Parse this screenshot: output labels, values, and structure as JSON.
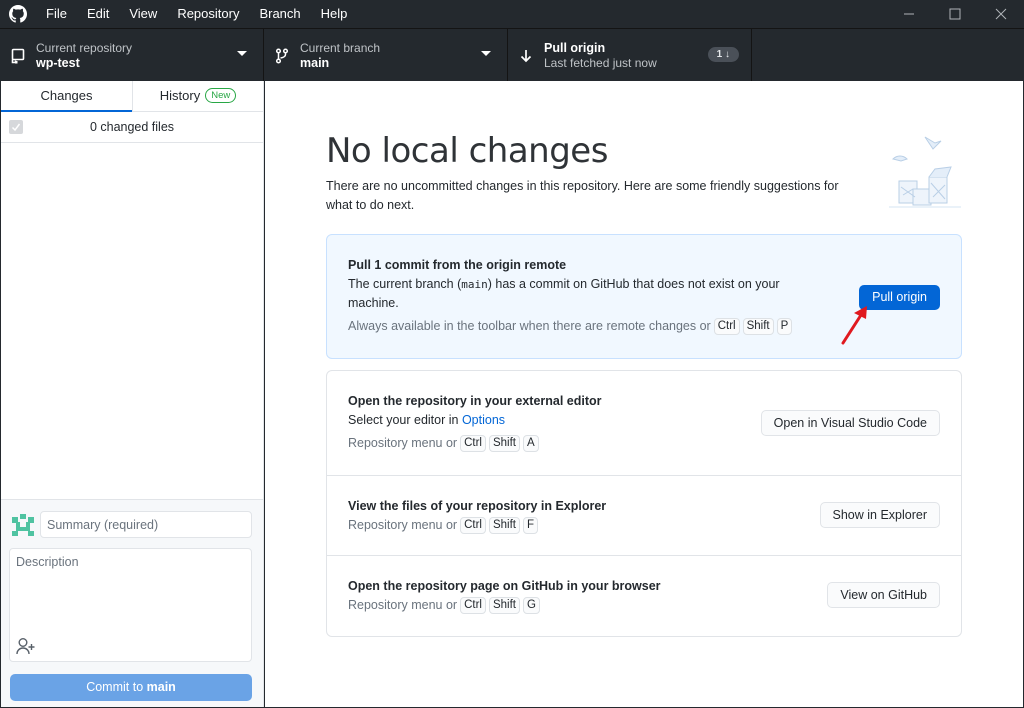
{
  "window": {
    "menu": [
      "File",
      "Edit",
      "View",
      "Repository",
      "Branch",
      "Help"
    ],
    "controls": [
      "minimize",
      "maximize",
      "close"
    ]
  },
  "toolbar": {
    "repository": {
      "label": "Current repository",
      "value": "wp-test"
    },
    "branch": {
      "label": "Current branch",
      "value": "main"
    },
    "pull": {
      "label": "Pull origin",
      "sublabel": "Last fetched just now",
      "badge": "1 ↓"
    }
  },
  "sidebar": {
    "tabs": [
      {
        "label": "Changes",
        "active": true
      },
      {
        "label": "History",
        "badge": "New",
        "active": false
      }
    ],
    "changed_files": "0 changed files",
    "commit": {
      "summary_placeholder": "Summary (required)",
      "description_placeholder": "Description",
      "button_prefix": "Commit to ",
      "button_branch": "main"
    }
  },
  "main": {
    "title": "No local changes",
    "description": "There are no uncommitted changes in this repository. Here are some friendly suggestions for what to do next.",
    "pull_card": {
      "title": "Pull 1 commit from the origin remote",
      "text_before": "The current branch (",
      "branch": "main",
      "text_after": ") has a commit on GitHub that does not exist on your machine.",
      "hint": "Always available in the toolbar when there are remote changes or",
      "keys": [
        "Ctrl",
        "Shift",
        "P"
      ],
      "button": "Pull origin"
    },
    "actions": [
      {
        "title": "Open the repository in your external editor",
        "text": "Select your editor in ",
        "link": "Options",
        "hint": "Repository menu or",
        "keys": [
          "Ctrl",
          "Shift",
          "A"
        ],
        "button": "Open in Visual Studio Code"
      },
      {
        "title": "View the files of your repository in Explorer",
        "hint": "Repository menu or",
        "keys": [
          "Ctrl",
          "Shift",
          "F"
        ],
        "button": "Show in Explorer"
      },
      {
        "title": "Open the repository page on GitHub in your browser",
        "hint": "Repository menu or",
        "keys": [
          "Ctrl",
          "Shift",
          "G"
        ],
        "button": "View on GitHub"
      }
    ]
  },
  "colors": {
    "accent": "#0366d6",
    "titlebar": "#24292e",
    "commit_button": "#6aa3e6",
    "new_badge": "#28a745",
    "annotation_arrow": "#e0191f"
  }
}
